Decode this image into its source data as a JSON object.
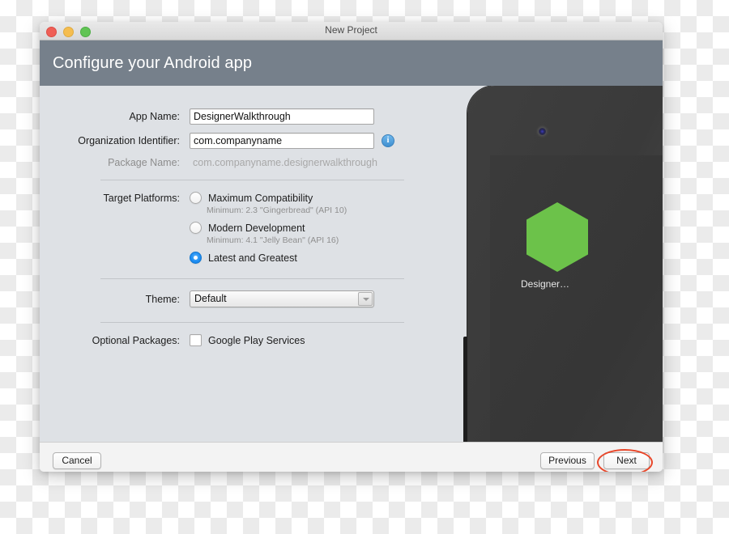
{
  "window": {
    "title": "New Project",
    "traffic_lights": [
      "close-button",
      "minimize-button",
      "maximize-button"
    ]
  },
  "header": {
    "title": "Configure your Android app",
    "background_color": "#76808b"
  },
  "form": {
    "app_name": {
      "label": "App Name:",
      "value": "DesignerWalkthrough",
      "placeholder": "App Name"
    },
    "organization_identifier": {
      "label": "Organization Identifier:",
      "value": "com.companyname",
      "placeholder": "com.companyname",
      "info_icon": "info-icon",
      "info_glyph": "i"
    },
    "package_name": {
      "label": "Package Name:",
      "value": "com.companyname.designerwalkthrough"
    },
    "target_platforms": {
      "label": "Target Platforms:",
      "options": [
        {
          "label": "Maximum Compatibility",
          "sublabel": "Minimum: 2.3 \"Gingerbread\" (API 10)",
          "selected": false
        },
        {
          "label": "Modern Development",
          "sublabel": "Minimum: 4.1 \"Jelly Bean\" (API 16)",
          "selected": false
        },
        {
          "label": "Latest and Greatest",
          "sublabel": "",
          "selected": true
        }
      ],
      "selected_color": "#1b8cf3"
    },
    "theme": {
      "label": "Theme:",
      "value": "Default",
      "arrow_icon": "chevron-down-icon"
    },
    "optional_packages": {
      "label": "Optional Packages:",
      "items": [
        {
          "label": "Google Play Services",
          "checked": false
        }
      ]
    }
  },
  "preview": {
    "device": "android-phone",
    "app_icon_name": "hexagon-app-icon",
    "app_icon_color": "#6cc24a",
    "app_label": "Designer…"
  },
  "footer": {
    "cancel_label": "Cancel",
    "previous_label": "Previous",
    "next_label": "Next",
    "annotation_color": "#e8472a"
  }
}
